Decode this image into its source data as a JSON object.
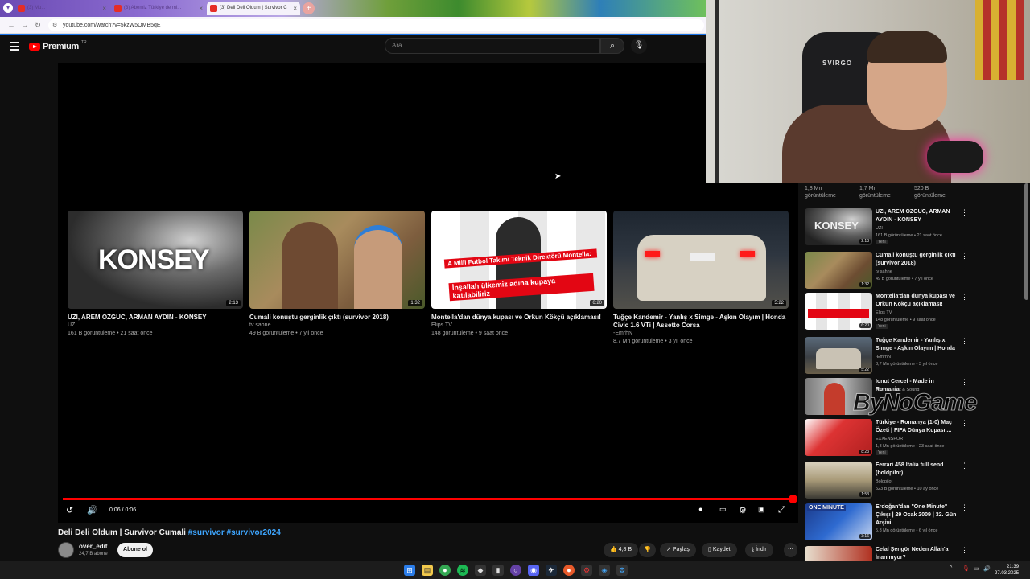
{
  "browser": {
    "tabs": [
      {
        "label": "(3) Mu..."
      },
      {
        "label": "(3) Abemiz Türkiye de mi..."
      },
      {
        "label": "(3) Deli Deli Oldum | Survivor C"
      }
    ],
    "url": "youtube.com/watch?v=5kzW5OMB5qE"
  },
  "youtube": {
    "logo_text": "Premium",
    "logo_region": "TR",
    "search_placeholder": "Ara"
  },
  "player": {
    "time": "0:06 / 0:06",
    "progress_fraction": 1.0,
    "endcards": [
      {
        "title": "UZI, AREM OZGUC, ARMAN AYDIN - KONSEY",
        "channel": "UZI",
        "meta": "161 B görüntüleme • 21 saat önce",
        "duration": "2:13",
        "thumb_text": "KONSEY"
      },
      {
        "title": "Cumali konuştu gerginlik çıktı (survivor 2018)",
        "channel": "tv sahne",
        "meta": "49 B görüntüleme • 7 yıl önce",
        "duration": "1:32"
      },
      {
        "title": "Montella'dan dünya kupası ve Orkun Kökçü açıklaması!",
        "channel": "Elips TV",
        "meta": "148 görüntüleme • 9 saat önce",
        "duration": "6:20",
        "thumb_caption_1": "A Milli Futbol Takımı Teknik Direktörü Montella:",
        "thumb_caption_2": "İnşallah ülkemiz adına kupaya katılabiliriz"
      },
      {
        "title": "Tuğçe Kandemir - Yanlış x Simge - Aşkın Olayım | Honda Civic 1.6 VTi | Assetto Corsa",
        "channel": "-EmrhN",
        "meta": "8,7 Mn görüntüleme • 3 yıl önce",
        "duration": "5:22"
      }
    ]
  },
  "video": {
    "title": "Deli Deli Oldum | Survivor Cumali ",
    "hashtags": "#survivor #survivor2024",
    "channel_name": "over_edit",
    "subscribers": "24,7 B abone",
    "subscribe_label": "Abone ol",
    "likes": "4,8 B",
    "share_label": "Paylaş",
    "save_label": "Kaydet",
    "download_label": "İndir"
  },
  "sidebar": {
    "stats": [
      {
        "line1": "1,8 Mn",
        "line2": "görüntüleme"
      },
      {
        "line1": "1,7 Mn",
        "line2": "görüntüleme"
      },
      {
        "line1": "520 B",
        "line2": "görüntüleme"
      }
    ],
    "items": [
      {
        "title": "UZI, AREM OZGUC, ARMAN AYDIN - KONSEY",
        "channel": "UZI",
        "meta": "161 B görüntüleme • 21 saat önce",
        "duration": "2:13",
        "badge": "Yeni"
      },
      {
        "title": "Cumali konuştu gerginlik çıktı (survivor 2018)",
        "channel": "tv sahne",
        "meta": "49 B görüntüleme • 7 yıl önce",
        "duration": "1:32",
        "badge": ""
      },
      {
        "title": "Montella'dan dünya kupası ve Orkun Kökçü açıklaması!",
        "channel": "Elips TV",
        "meta": "148 görüntüleme • 9 saat önce",
        "duration": "6:20",
        "badge": "Yeni"
      },
      {
        "title": "Tuğçe Kandemir - Yanlış x Simge - Aşkın Olayım | Honda ...",
        "channel": "-EmrhN",
        "meta": "8,7 Mn görüntüleme • 3 yıl önce",
        "duration": "5:22",
        "badge": ""
      },
      {
        "title": "Ionut Cercel - Made in Romania",
        "channel": "Amma Music & Sound",
        "meta": "",
        "duration": "",
        "badge": ""
      },
      {
        "title": "Türkiye - Romanya (1-0) Maç Özeti | FIFA Dünya Kupası ...",
        "channel": "EXXENSPOR",
        "meta": "1,3 Mn görüntüleme • 23 saat önce",
        "duration": "8:23",
        "badge": "Yeni"
      },
      {
        "title": "Ferrari 458 Italia full send (boldpilot)",
        "channel": "Boldpilot",
        "meta": "523 B görüntüleme • 10 ay önce",
        "duration": "1:53",
        "badge": ""
      },
      {
        "title": "Erdoğan'dan \"One Minute\" Çıkışı | 29 Ocak 2009 | 32. Gün Arşivi",
        "channel": "32.Gün",
        "meta": "5,8 Mn görüntüleme • 6 yıl önce",
        "duration": "3:16",
        "badge": ""
      },
      {
        "title": "Celal Şengör Neden Allah'a İnanmıyor?",
        "channel": "",
        "meta": "",
        "duration": "",
        "badge": ""
      }
    ]
  },
  "overlay": {
    "watermark": "ByNoGame",
    "webcam_chair_brand": "SVIRGO"
  },
  "taskbar": {
    "time": "21:39",
    "date": "27.03.2025"
  }
}
